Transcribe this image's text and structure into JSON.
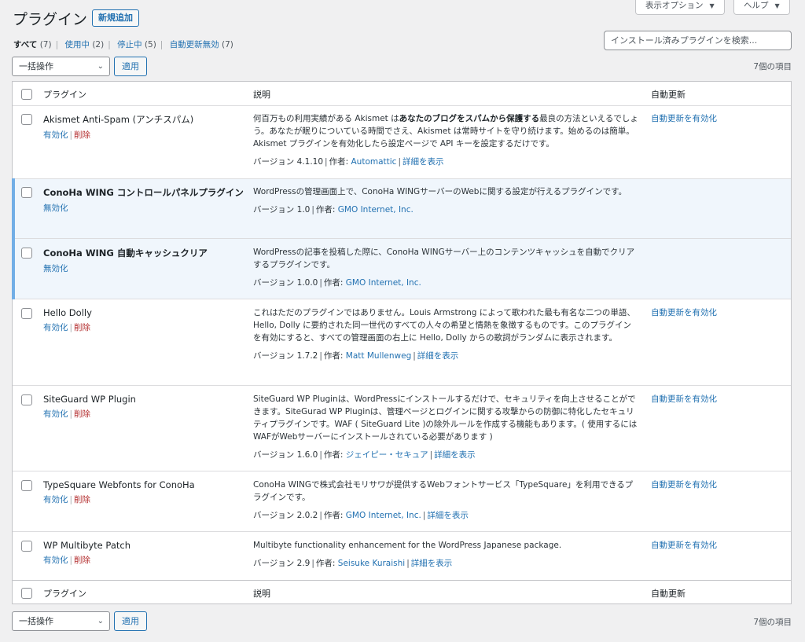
{
  "header": {
    "title": "プラグイン",
    "add_new": "新規追加",
    "screen_options": "表示オプション",
    "help": "ヘルプ"
  },
  "filters": [
    {
      "label": "すべて",
      "count": "(7)"
    },
    {
      "label": "使用中",
      "count": "(2)"
    },
    {
      "label": "停止中",
      "count": "(5)"
    },
    {
      "label": "自動更新無効",
      "count": "(7)"
    }
  ],
  "search": {
    "placeholder": "インストール済みプラグインを検索..."
  },
  "bulk": {
    "select": "一括操作",
    "apply": "適用",
    "count": "7個の項目"
  },
  "columns": {
    "plugin": "プラグイン",
    "desc": "説明",
    "auto": "自動更新"
  },
  "labels": {
    "activate": "有効化",
    "deactivate": "無効化",
    "delete": "削除",
    "enable_auto": "自動更新を有効化",
    "version_prefix": "バージョン",
    "author_prefix": "作者:",
    "details": "詳細を表示"
  },
  "plugins": [
    {
      "name": "Akismet Anti-Spam (アンチスパム)",
      "desc_pre": "何百万もの利用実績がある Akismet は",
      "desc_bold": "あなたのブログをスパムから保護する",
      "desc_post": "最良の方法といえるでしょう。あなたが眠りについている時間でさえ、Akismet は常時サイトを守り続けます。始めるのは簡単。Akismet プラグインを有効化したら設定ページで API キーを設定するだけです。",
      "version": "4.1.10",
      "author": "Automattic"
    },
    {
      "name": "ConoHa WING コントロールパネルプラグイン",
      "desc": "WordPressの管理画面上で、ConoHa WINGサーバーのWebに関する設定が行えるプラグインです。",
      "version": "1.0",
      "author": "GMO Internet, Inc."
    },
    {
      "name": "ConoHa WING 自動キャッシュクリア",
      "desc": "WordPressの記事を投稿した際に、ConoHa WINGサーバー上のコンテンツキャッシュを自動でクリアするプラグインです。",
      "version": "1.0.0",
      "author": "GMO Internet, Inc."
    },
    {
      "name": "Hello Dolly",
      "desc": "これはただのプラグインではありません。Louis Armstrong によって歌われた最も有名な二つの単語、Hello, Dolly に要約された同一世代のすべての人々の希望と情熱を象徴するものです。このプラグインを有効にすると、すべての管理画面の右上に Hello, Dolly からの歌詞がランダムに表示されます。",
      "version": "1.7.2",
      "author": "Matt Mullenweg"
    },
    {
      "name": "SiteGuard WP Plugin",
      "desc": "SiteGuard WP Pluginは、WordPressにインストールするだけで、セキュリティを向上させることができます。SiteGurad WP Pluginは、管理ページとログインに関する攻撃からの防御に特化したセキュリティプラグインです。WAF ( SiteGuard Lite )の除外ルールを作成する機能もあります。( 使用するにはWAFがWebサーバーにインストールされている必要があります )",
      "version": "1.6.0",
      "author": "ジェイピー・セキュア"
    },
    {
      "name": "TypeSquare Webfonts for ConoHa",
      "desc": "ConoHa WINGで株式会社モリサワが提供するWebフォントサービス「TypeSquare」を利用できるプラグインです。",
      "version": "2.0.2",
      "author": "GMO Internet, Inc."
    },
    {
      "name": "WP Multibyte Patch",
      "desc": "Multibyte functionality enhancement for the WordPress Japanese package.",
      "version": "2.9",
      "author": "Seisuke Kuraishi"
    }
  ]
}
